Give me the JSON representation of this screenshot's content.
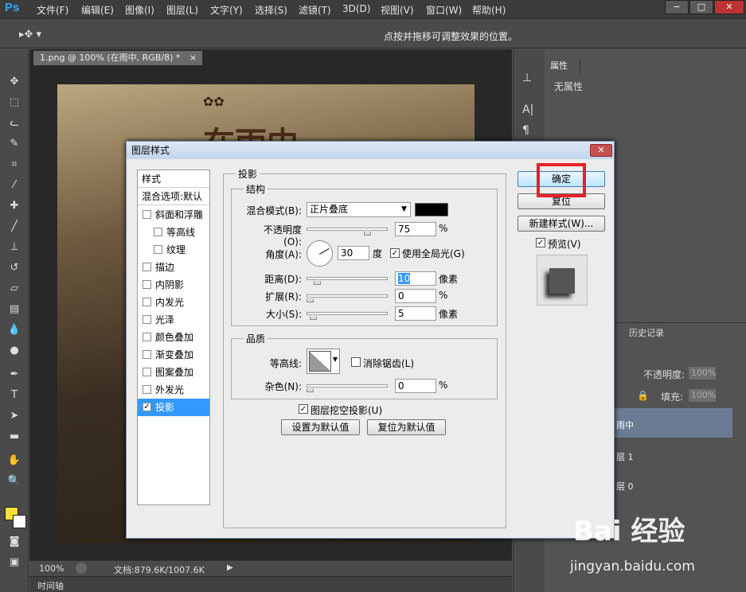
{
  "app": {
    "logo": "Ps"
  },
  "menu": [
    "文件(F)",
    "编辑(E)",
    "图像(I)",
    "图层(L)",
    "文字(Y)",
    "选择(S)",
    "滤镜(T)",
    "3D(D)",
    "视图(V)",
    "窗口(W)",
    "帮助(H)"
  ],
  "window_controls": {
    "minimize": "−",
    "maximize": "□",
    "close": "✕"
  },
  "options_hint": "点按并拖移可调整效果的位置。",
  "doc_tab": "1.png @ 100% (在雨中, RGB/8) *",
  "doc_tab_close": "×",
  "canvas_text": "在雨中",
  "status": {
    "zoom": "100%",
    "doc": "文档:879.6K/1007.6K"
  },
  "timeline": "时间轴",
  "panels": {
    "properties_tab": "属性",
    "no_properties": "无属性",
    "history_tab": "历史记录",
    "opacity_label": "不透明度:",
    "opacity_value": "100%",
    "fill_label": "填充:",
    "fill_value": "100%",
    "layers": [
      "雨中",
      "层 1",
      "层 0"
    ]
  },
  "dialog": {
    "title": "图层样式",
    "close": "✕",
    "style_list": [
      {
        "label": "样式",
        "type": "head"
      },
      {
        "label": "混合选项:默认",
        "type": "head"
      },
      {
        "label": "斜面和浮雕",
        "type": "item",
        "checked": false
      },
      {
        "label": "等高线",
        "type": "sub",
        "checked": false
      },
      {
        "label": "纹理",
        "type": "sub",
        "checked": false
      },
      {
        "label": "描边",
        "type": "item",
        "checked": false
      },
      {
        "label": "内阴影",
        "type": "item",
        "checked": false
      },
      {
        "label": "内发光",
        "type": "item",
        "checked": false
      },
      {
        "label": "光泽",
        "type": "item",
        "checked": false
      },
      {
        "label": "颜色叠加",
        "type": "item",
        "checked": false
      },
      {
        "label": "渐变叠加",
        "type": "item",
        "checked": false
      },
      {
        "label": "图案叠加",
        "type": "item",
        "checked": false
      },
      {
        "label": "外发光",
        "type": "item",
        "checked": false
      },
      {
        "label": "投影",
        "type": "item",
        "checked": true,
        "selected": true
      }
    ],
    "section_title": "投影",
    "structure": {
      "title": "结构",
      "blend_mode_label": "混合模式(B):",
      "blend_mode_value": "正片叠底",
      "blend_color": "#000000",
      "opacity_label": "不透明度(O):",
      "opacity_value": "75",
      "angle_label": "角度(A):",
      "angle_value": "30",
      "angle_unit": "度",
      "global_light_label": "使用全局光(G)",
      "global_light_checked": true,
      "distance_label": "距离(D):",
      "distance_value": "10",
      "distance_unit": "像素",
      "spread_label": "扩展(R):",
      "spread_value": "0",
      "size_label": "大小(S):",
      "size_value": "5",
      "size_unit": "像素",
      "percent": "%"
    },
    "quality": {
      "title": "品质",
      "contour_label": "等高线:",
      "antialias_label": "消除锯齿(L)",
      "noise_label": "杂色(N):",
      "noise_value": "0",
      "percent": "%"
    },
    "knockout_label": "图层挖空投影(U)",
    "knockout_checked": true,
    "make_default": "设置为默认值",
    "reset_default": "复位为默认值",
    "buttons": {
      "ok": "确定",
      "reset": "复位",
      "new_style": "新建样式(W)..."
    },
    "preview_label": "预览(V)",
    "preview_checked": true
  },
  "watermark": {
    "main": "Bai 经验",
    "sub": "jingyan.baidu.com"
  }
}
